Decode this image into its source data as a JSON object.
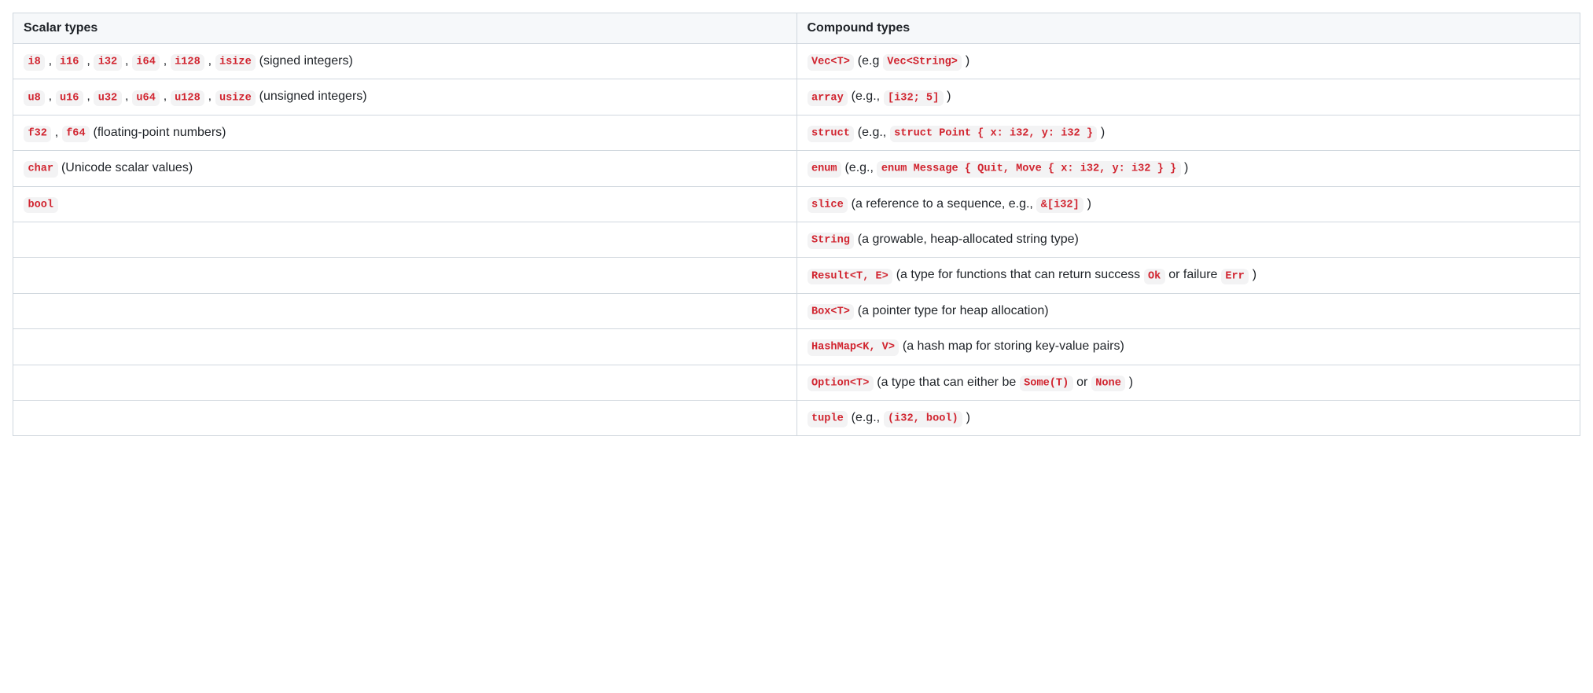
{
  "headers": [
    "Scalar types",
    "Compound types"
  ],
  "rows": [
    {
      "scalar": {
        "content": [
          {
            "type": "code",
            "v": "i8"
          },
          {
            "type": "text",
            "v": " , "
          },
          {
            "type": "code",
            "v": "i16"
          },
          {
            "type": "text",
            "v": " , "
          },
          {
            "type": "code",
            "v": "i32"
          },
          {
            "type": "text",
            "v": " , "
          },
          {
            "type": "code",
            "v": "i64"
          },
          {
            "type": "text",
            "v": " , "
          },
          {
            "type": "code",
            "v": "i128"
          },
          {
            "type": "text",
            "v": " , "
          },
          {
            "type": "code",
            "v": "isize"
          },
          {
            "type": "text",
            "v": " (signed integers)"
          }
        ]
      },
      "compound": {
        "content": [
          {
            "type": "code",
            "v": "Vec<T>"
          },
          {
            "type": "text",
            "v": " (e.g "
          },
          {
            "type": "code",
            "v": "Vec<String>"
          },
          {
            "type": "text",
            "v": " )"
          }
        ]
      }
    },
    {
      "scalar": {
        "content": [
          {
            "type": "code",
            "v": "u8"
          },
          {
            "type": "text",
            "v": " , "
          },
          {
            "type": "code",
            "v": "u16"
          },
          {
            "type": "text",
            "v": " , "
          },
          {
            "type": "code",
            "v": "u32"
          },
          {
            "type": "text",
            "v": " , "
          },
          {
            "type": "code",
            "v": "u64"
          },
          {
            "type": "text",
            "v": " , "
          },
          {
            "type": "code",
            "v": "u128"
          },
          {
            "type": "text",
            "v": " , "
          },
          {
            "type": "code",
            "v": "usize"
          },
          {
            "type": "text",
            "v": " (unsigned integers)"
          }
        ]
      },
      "compound": {
        "content": [
          {
            "type": "code",
            "v": "array"
          },
          {
            "type": "text",
            "v": " (e.g., "
          },
          {
            "type": "code",
            "v": "[i32; 5]"
          },
          {
            "type": "text",
            "v": " )"
          }
        ]
      }
    },
    {
      "scalar": {
        "content": [
          {
            "type": "code",
            "v": "f32"
          },
          {
            "type": "text",
            "v": " , "
          },
          {
            "type": "code",
            "v": "f64"
          },
          {
            "type": "text",
            "v": " (floating-point numbers)"
          }
        ]
      },
      "compound": {
        "content": [
          {
            "type": "code",
            "v": "struct"
          },
          {
            "type": "text",
            "v": " (e.g., "
          },
          {
            "type": "code",
            "v": "struct Point { x: i32, y: i32 }"
          },
          {
            "type": "text",
            "v": " )"
          }
        ]
      }
    },
    {
      "scalar": {
        "content": [
          {
            "type": "code",
            "v": "char"
          },
          {
            "type": "text",
            "v": " (Unicode scalar values)"
          }
        ]
      },
      "compound": {
        "content": [
          {
            "type": "code",
            "v": "enum"
          },
          {
            "type": "text",
            "v": " (e.g., "
          },
          {
            "type": "code",
            "v": "enum Message { Quit, Move { x: i32, y: i32 } }"
          },
          {
            "type": "text",
            "v": " )"
          }
        ]
      }
    },
    {
      "scalar": {
        "content": [
          {
            "type": "code",
            "v": "bool"
          }
        ]
      },
      "compound": {
        "content": [
          {
            "type": "code",
            "v": "slice"
          },
          {
            "type": "text",
            "v": " (a reference to a sequence, e.g., "
          },
          {
            "type": "code",
            "v": "&[i32]"
          },
          {
            "type": "text",
            "v": " )"
          }
        ]
      }
    },
    {
      "scalar": {
        "content": []
      },
      "compound": {
        "content": [
          {
            "type": "code",
            "v": "String"
          },
          {
            "type": "text",
            "v": " (a growable, heap-allocated string type)"
          }
        ]
      }
    },
    {
      "scalar": {
        "content": []
      },
      "compound": {
        "content": [
          {
            "type": "code",
            "v": "Result<T, E>"
          },
          {
            "type": "text",
            "v": " (a type for functions that can return success "
          },
          {
            "type": "code",
            "v": "Ok"
          },
          {
            "type": "text",
            "v": " or failure "
          },
          {
            "type": "code",
            "v": "Err"
          },
          {
            "type": "text",
            "v": " )"
          }
        ]
      }
    },
    {
      "scalar": {
        "content": []
      },
      "compound": {
        "content": [
          {
            "type": "code",
            "v": "Box<T>"
          },
          {
            "type": "text",
            "v": " (a pointer type for heap allocation)"
          }
        ]
      }
    },
    {
      "scalar": {
        "content": []
      },
      "compound": {
        "content": [
          {
            "type": "code",
            "v": "HashMap<K, V>"
          },
          {
            "type": "text",
            "v": " (a hash map for storing key-value pairs)"
          }
        ]
      }
    },
    {
      "scalar": {
        "content": []
      },
      "compound": {
        "content": [
          {
            "type": "code",
            "v": "Option<T>"
          },
          {
            "type": "text",
            "v": " (a type that can either be "
          },
          {
            "type": "code",
            "v": "Some(T)"
          },
          {
            "type": "text",
            "v": " or "
          },
          {
            "type": "code",
            "v": "None"
          },
          {
            "type": "text",
            "v": " )"
          }
        ]
      }
    },
    {
      "scalar": {
        "content": []
      },
      "compound": {
        "content": [
          {
            "type": "code",
            "v": "tuple"
          },
          {
            "type": "text",
            "v": " (e.g., "
          },
          {
            "type": "code",
            "v": "(i32, bool)"
          },
          {
            "type": "text",
            "v": " )"
          }
        ]
      }
    }
  ]
}
